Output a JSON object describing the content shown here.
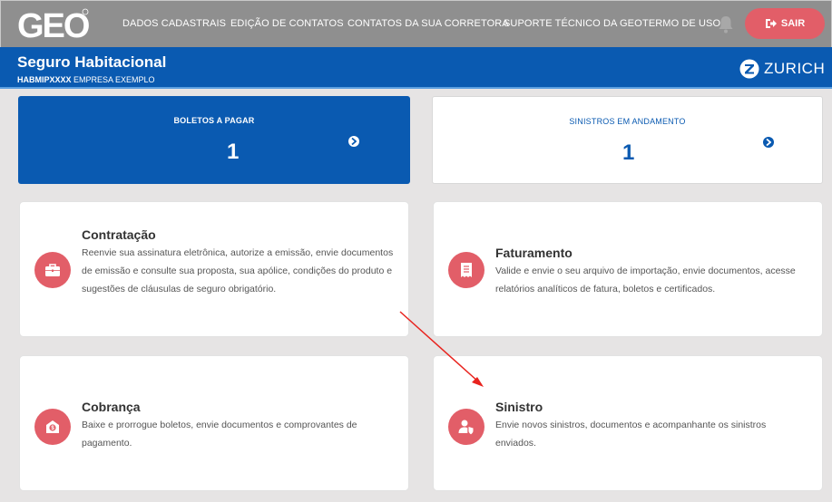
{
  "header": {
    "logo_text": "GEO",
    "nav": [
      "DADOS CADASTRAIS",
      "EDIÇÃO DE CONTATOS",
      "CONTATOS DA SUA CORRETORA",
      "SUPORTE TÉCNICO DA GEO",
      "TERMO DE USO"
    ],
    "logout_label": "SAIR"
  },
  "product": {
    "title": "Seguro Habitacional",
    "code": "HABMIPXXXX",
    "company": "EMPRESA EXEMPLO",
    "partner": "ZURICH"
  },
  "summary": [
    {
      "label": "BOLETOS A PAGAR",
      "count": "1"
    },
    {
      "label": "SINISTROS EM ANDAMENTO",
      "count": "1"
    }
  ],
  "cards": [
    {
      "title": "Contratação",
      "text": "Reenvie sua assinatura eletrônica, autorize a emissão, envie documentos de emissão e consulte sua proposta, sua apólice, condições do produto e sugestões de cláusulas de seguro obrigatório.",
      "icon": "briefcase-icon"
    },
    {
      "title": "Faturamento",
      "text": "Valide e envie o seu arquivo de importação, envie documentos, acesse relatórios analíticos de fatura, boletos e certificados.",
      "icon": "receipt-icon"
    },
    {
      "title": "Cobrança",
      "text": "Baixe e prorrogue boletos, envie documentos e comprovantes de pagamento.",
      "icon": "dollar-invoice-icon"
    },
    {
      "title": "Sinistro",
      "text": "Envie novos sinistros, documentos e acompanhante os sinistros enviados.",
      "icon": "person-shield-icon"
    }
  ],
  "colors": {
    "accent": "#e25e68",
    "brand_blue": "#0a5ab1",
    "header_gray": "#8f8f8f"
  }
}
